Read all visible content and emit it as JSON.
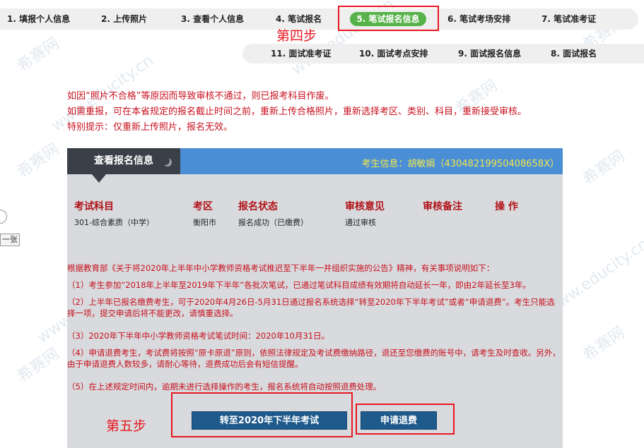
{
  "steps_row1": [
    {
      "label": "1. 填报个人信息"
    },
    {
      "label": "2. 上传照片"
    },
    {
      "label": "3. 查看个人信息"
    },
    {
      "label": "4. 笔试报名"
    },
    {
      "label": "5. 笔试报名信息",
      "active": true
    },
    {
      "label": "6. 笔试考场安排"
    },
    {
      "label": "7. 笔试准考证"
    }
  ],
  "steps_row2": [
    {
      "label": "11. 面试准考证"
    },
    {
      "label": "10. 面试考点安排"
    },
    {
      "label": "9. 面试报名信息"
    },
    {
      "label": "8. 面试报名"
    }
  ],
  "annotations": {
    "step4": "第四步",
    "step5": "第五步"
  },
  "warnings": [
    "如因“照片不合格”等原因而导致审核不通过，则已报考科目作废。",
    "如需重报，可在本省规定的报名截止时间之前，重新上传合格照片，重新选择考区、类别、科目，重新接受审核。",
    "特别提示：仅重新上传照片，报名无效。"
  ],
  "panel": {
    "tab_label": "查看报名信息",
    "candidate_info": "考生信息：胡敏娟（43048219950408658X）"
  },
  "table": {
    "headers": [
      "考试科目",
      "考区",
      "报名状态",
      "审核意见",
      "审核备注",
      "操 作"
    ],
    "rows": [
      [
        "301-综合素质（中学）",
        "衡阳市",
        "报名成功（已缴费）",
        "通过审核",
        "",
        ""
      ]
    ]
  },
  "notice": {
    "intro": "根据教育部《关于将2020年上半年中小学教师资格考试推迟至下半年一并组织实施的公告》精神，有关事项说明如下：",
    "items": [
      "（1）考生参加“2018年上半年至2019年下半年”各批次笔试，已通过笔试科目成绩有效期将自动延长一年，即由2年延长至3年。",
      "（2）上半年已报名缴费考生，可于2020年4月26日-5月31日通过报名系统选择“转至2020年下半年考试”或者“申请退费”。考生只能选择一项，提交申请后将不能更改，请慎重选择。",
      "（3）2020年下半年中小学教师资格考试笔试时间：2020年10月31日。",
      "（4）申请退费考生，考试费将按照“原卡原退”原则，依照法律规定及考试费缴纳路径，退还至您缴费的账号中，请考生及时查收。另外，由于申请退费人数较多，请耐心等待，退费成功后会有短信提醒。",
      "（5）在上述规定时间内，逾期未进行选择操作的考生，报名系统将自动按照退费处理。"
    ]
  },
  "buttons": {
    "transfer": "转至2020年下半年考试",
    "refund": "申请退费"
  },
  "edge": {
    "tag": "一张"
  },
  "watermark": {
    "brand": "希赛网",
    "url": "www.educity.cn"
  },
  "colors": {
    "accent_red": "#e8171f",
    "active_step": "#58b24a",
    "panel_header": "#4a8ed6",
    "tab_dark": "#3a3f48",
    "button": "#1f5a8c"
  }
}
